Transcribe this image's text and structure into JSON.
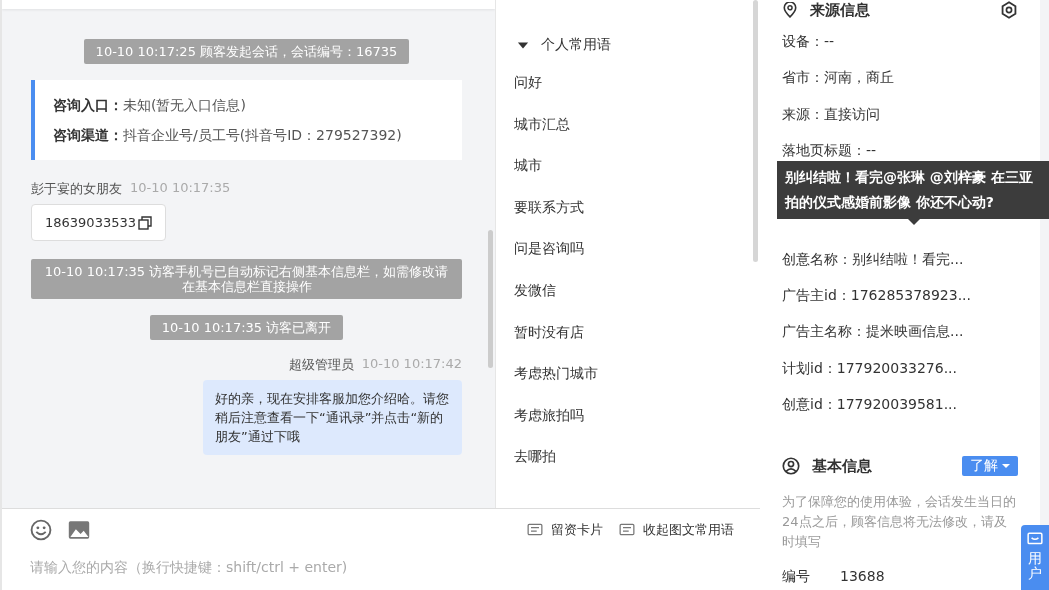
{
  "chat": {
    "messages": [
      {
        "kind": "system",
        "text": "10-10 10:17:25 顾客发起会话，会话编号：16735"
      },
      {
        "kind": "info",
        "lines": [
          {
            "label": "咨询入口：",
            "value": "未知(暂无入口信息)"
          },
          {
            "label": "咨询渠道：",
            "value": "抖音企业号/员工号(抖音号ID：279527392)"
          }
        ]
      },
      {
        "kind": "visitor",
        "sender": "彭于宴的女朋友",
        "time": "10-10 10:17:35",
        "text": "18639033533"
      },
      {
        "kind": "system",
        "text": "10-10 10:17:35 访客手机号已自动标记右侧基本信息栏，如需修改请在基本信息栏直接操作"
      },
      {
        "kind": "system",
        "text": "10-10 10:17:35 访客已离开"
      },
      {
        "kind": "agent",
        "sender": "超级管理员",
        "time": "10-10 10:17:42",
        "text": "好的亲，现在安排客服加您介绍哈。请您稍后注意查看一下“通讯录”并点击“新的朋友”通过下哦"
      }
    ]
  },
  "phrases": {
    "group": {
      "title": "个人常用语",
      "expanded": true
    },
    "items": [
      "问好",
      "城市汇总",
      "城市",
      "要联系方式",
      "问是咨询吗",
      "发微信",
      "暂时没有店",
      "考虑热门城市",
      "考虑旅拍吗",
      "去哪拍"
    ]
  },
  "input": {
    "placeholder": "请输入您的内容（换行快捷键：shift/ctrl + enter)",
    "actions": [
      "留资卡片",
      "收起图文常用语"
    ]
  },
  "source_info": {
    "title": "来源信息",
    "rows_before": [
      "设备：--",
      "省市：河南，商丘",
      "来源：直接访问",
      "落地页标题：--"
    ],
    "tooltip": "别纠结啦！看完@张琳 @刘梓豪 在三亚拍的仪式感婚前影像 你还不心动?",
    "rows_after": [
      "创意名称：别纠结啦！看完...",
      "广告主id：176285378923...",
      "广告主名称：提米映画信息...",
      "计划id：177920033276...",
      "创意id：177920039581..."
    ]
  },
  "basic_info": {
    "title": "基本信息",
    "button": "了解",
    "note": "为了保障您的使用体验，会话发生当日的24点之后，顾客信息将无法修改，请及时填写",
    "fields": [
      {
        "label": "编号",
        "value": "13688"
      }
    ]
  },
  "side_tab": {
    "label": "用户"
  }
}
